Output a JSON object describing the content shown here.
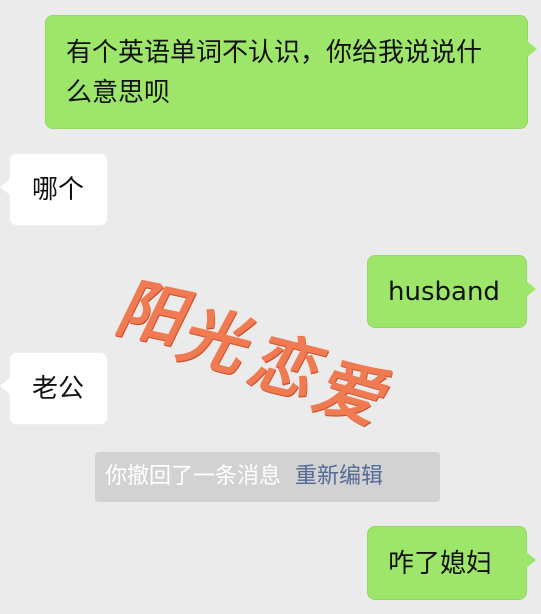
{
  "messages": [
    {
      "from": "me",
      "text": "有个英语单词不认识，你给我说说什么意思呗"
    },
    {
      "from": "them",
      "text": "哪个"
    },
    {
      "from": "me",
      "text": "husband"
    },
    {
      "from": "them",
      "text": "老公"
    },
    {
      "from": "me",
      "text": "咋了媳妇"
    }
  ],
  "recall_notice": {
    "text": "你撤回了一条消息",
    "edit_link": "重新编辑"
  },
  "watermark": {
    "chars": [
      "阳",
      "光",
      "恋",
      "爱"
    ]
  },
  "colors": {
    "background": "#ebebeb",
    "outgoing_bubble": "#9de66a",
    "incoming_bubble": "#ffffff",
    "recall_pill": "#d2d2d2",
    "edit_link": "#546b97",
    "watermark": "#f07a52"
  }
}
